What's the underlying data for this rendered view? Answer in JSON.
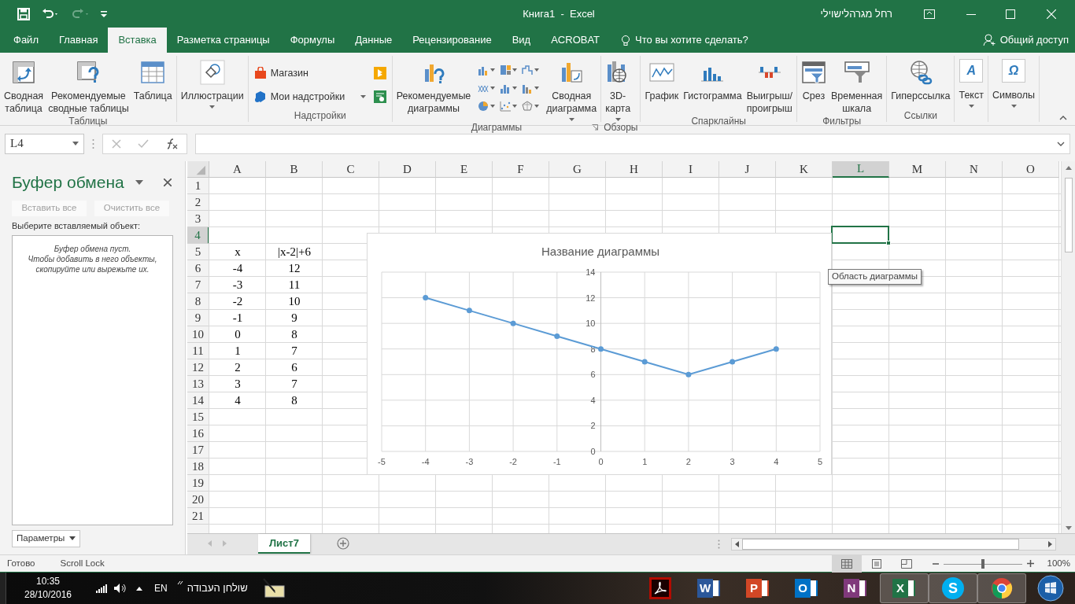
{
  "window": {
    "title": "Книга1  -  Excel",
    "user": "רחל מגרהלישוילי"
  },
  "tabs": [
    {
      "label": "Файл",
      "selected": false
    },
    {
      "label": "Главная",
      "selected": false
    },
    {
      "label": "Вставка",
      "selected": true
    },
    {
      "label": "Разметка страницы",
      "selected": false
    },
    {
      "label": "Формулы",
      "selected": false
    },
    {
      "label": "Данные",
      "selected": false
    },
    {
      "label": "Рецензирование",
      "selected": false
    },
    {
      "label": "Вид",
      "selected": false
    },
    {
      "label": "ACROBAT",
      "selected": false
    }
  ],
  "tell_me": "Что вы хотите сделать?",
  "share": "Общий доступ",
  "ribbon": {
    "groups": [
      {
        "label": "Таблицы",
        "items": [
          {
            "kind": "large",
            "label": "Сводная\nтаблица"
          },
          {
            "kind": "large",
            "label": "Рекомендуемые\nсводные таблицы"
          },
          {
            "kind": "large",
            "label": "Таблица"
          }
        ]
      },
      {
        "items": [
          {
            "kind": "large",
            "label": "Иллюстрации",
            "dropdown": true
          }
        ]
      },
      {
        "label": "Надстройки",
        "items": [
          {
            "kind": "small",
            "label": "Магазин"
          },
          {
            "kind": "small",
            "label": "Мои надстройки",
            "dropdown": true
          },
          {
            "kind": "addin-icons"
          }
        ]
      },
      {
        "label": "Диаграммы",
        "launcher": true,
        "items": [
          {
            "kind": "large",
            "label": "Рекомендуемые\nдиаграммы"
          },
          {
            "kind": "chart-gallery"
          },
          {
            "kind": "large",
            "label": "Сводная\nдиаграмма",
            "dropdown": true
          }
        ]
      },
      {
        "label": "Обзоры",
        "items": [
          {
            "kind": "large",
            "label": "3D-\nкарта",
            "dropdown": true
          }
        ]
      },
      {
        "label": "Спарклайны",
        "items": [
          {
            "kind": "large",
            "label": "График"
          },
          {
            "kind": "large",
            "label": "Гистограмма"
          },
          {
            "kind": "large",
            "label": "Выигрыш/\nпроигрыш"
          }
        ]
      },
      {
        "label": "Фильтры",
        "items": [
          {
            "kind": "large",
            "label": "Срез"
          },
          {
            "kind": "large",
            "label": "Временная\nшкала"
          }
        ]
      },
      {
        "label": "Ссылки",
        "items": [
          {
            "kind": "large",
            "label": "Гиперссылка"
          }
        ]
      },
      {
        "items": [
          {
            "kind": "glyph",
            "glyph": "A",
            "label": "Текст",
            "dropdown": true
          }
        ]
      },
      {
        "items": [
          {
            "kind": "glyph",
            "glyph": "Ω",
            "label": "Символы",
            "dropdown": true
          }
        ]
      }
    ]
  },
  "formula_bar": {
    "name_box": "L4"
  },
  "clipboard_pane": {
    "title": "Буфер обмена",
    "buttons": [
      {
        "label": "Вставить все",
        "disabled": true
      },
      {
        "label": "Очистить все",
        "disabled": true
      }
    ],
    "prompt": "Выберите вставляемый объект:",
    "empty_message": "Буфер обмена пуст.\nЧтобы добавить в него объекты,\nскопируйте или вырежьте их.",
    "options_button": "Параметры"
  },
  "sheet": {
    "columns": [
      {
        "label": "A",
        "selected": false
      },
      {
        "label": "B",
        "selected": false
      },
      {
        "label": "C",
        "selected": false
      },
      {
        "label": "D",
        "selected": false
      },
      {
        "label": "E",
        "selected": false
      },
      {
        "label": "F",
        "selected": false
      },
      {
        "label": "G",
        "selected": false
      },
      {
        "label": "H",
        "selected": false
      },
      {
        "label": "I",
        "selected": false
      },
      {
        "label": "J",
        "selected": false
      },
      {
        "label": "K",
        "selected": false
      },
      {
        "label": "L",
        "selected": true
      },
      {
        "label": "M",
        "selected": false
      },
      {
        "label": "N",
        "selected": false
      },
      {
        "label": "O",
        "selected": false
      }
    ],
    "rows": [
      {
        "label": "1",
        "selected": false
      },
      {
        "label": "2",
        "selected": false
      },
      {
        "label": "3",
        "selected": false
      },
      {
        "label": "4",
        "selected": true
      },
      {
        "label": "5",
        "selected": false,
        "cells": [
          "x",
          "|x-2|+6"
        ]
      },
      {
        "label": "6",
        "selected": false,
        "cells": [
          "-4",
          "12"
        ]
      },
      {
        "label": "7",
        "selected": false,
        "cells": [
          "-3",
          "11"
        ]
      },
      {
        "label": "8",
        "selected": false,
        "cells": [
          "-2",
          "10"
        ]
      },
      {
        "label": "9",
        "selected": false,
        "cells": [
          "-1",
          "9"
        ]
      },
      {
        "label": "10",
        "selected": false,
        "cells": [
          "0",
          "8"
        ]
      },
      {
        "label": "11",
        "selected": false,
        "cells": [
          "1",
          "7"
        ]
      },
      {
        "label": "12",
        "selected": false,
        "cells": [
          "2",
          "6"
        ]
      },
      {
        "label": "13",
        "selected": false,
        "cells": [
          "3",
          "7"
        ]
      },
      {
        "label": "14",
        "selected": false,
        "cells": [
          "4",
          "8"
        ]
      },
      {
        "label": "15",
        "selected": false
      },
      {
        "label": "16",
        "selected": false
      },
      {
        "label": "17",
        "selected": false
      },
      {
        "label": "18",
        "selected": false
      },
      {
        "label": "19",
        "selected": false
      },
      {
        "label": "20",
        "selected": false
      },
      {
        "label": "21",
        "selected": false
      }
    ]
  },
  "chart": {
    "tooltip": "Область диаграммы",
    "chart_data": {
      "type": "line",
      "title": "Название диаграммы",
      "x": [
        -4,
        -3,
        -2,
        -1,
        0,
        1,
        2,
        3,
        4
      ],
      "series": [
        {
          "color": "#5b9bd5",
          "marker": "circle",
          "values": [
            12,
            11,
            10,
            9,
            8,
            7,
            6,
            7,
            8
          ]
        }
      ],
      "grid": true,
      "xlim": [
        -5,
        5
      ],
      "ylim": [
        0,
        14
      ],
      "xticks": [
        -5,
        -4,
        -3,
        -2,
        -1,
        0,
        1,
        2,
        3,
        4,
        5
      ],
      "yticks": [
        0,
        2,
        4,
        6,
        8,
        10,
        12,
        14
      ]
    }
  },
  "sheet_tabs": [
    {
      "label": "Лист7",
      "selected": true
    }
  ],
  "status_bar": {
    "items": [
      "Готово",
      "Scroll Lock"
    ],
    "views": [
      {
        "selected": true
      },
      {
        "selected": false
      },
      {
        "selected": false
      }
    ],
    "zoom": {
      "level": 0.5,
      "reading": "100%"
    }
  },
  "taskbar": {
    "time": "10:35",
    "date": "28/10/2016",
    "language": "EN",
    "toolbar": "שולחן העבודה",
    "apps": [
      {
        "kind": "acrobat",
        "color": "#b30b00",
        "active": false
      },
      {
        "kind": "tile",
        "glyph": "W",
        "color": "#2b579a",
        "active": false
      },
      {
        "kind": "tile",
        "glyph": "P",
        "color": "#d24726",
        "active": false
      },
      {
        "kind": "tile",
        "glyph": "O",
        "color": "#0072c6",
        "active": false
      },
      {
        "kind": "tile",
        "glyph": "N",
        "color": "#80397b",
        "active": false
      },
      {
        "kind": "tile",
        "glyph": "X",
        "color": "#217346",
        "active": true
      },
      {
        "kind": "skype",
        "glyph": "S",
        "color": "#00aff0",
        "active": true
      },
      {
        "kind": "chrome",
        "active": true
      },
      {
        "kind": "start",
        "active": false
      }
    ]
  }
}
